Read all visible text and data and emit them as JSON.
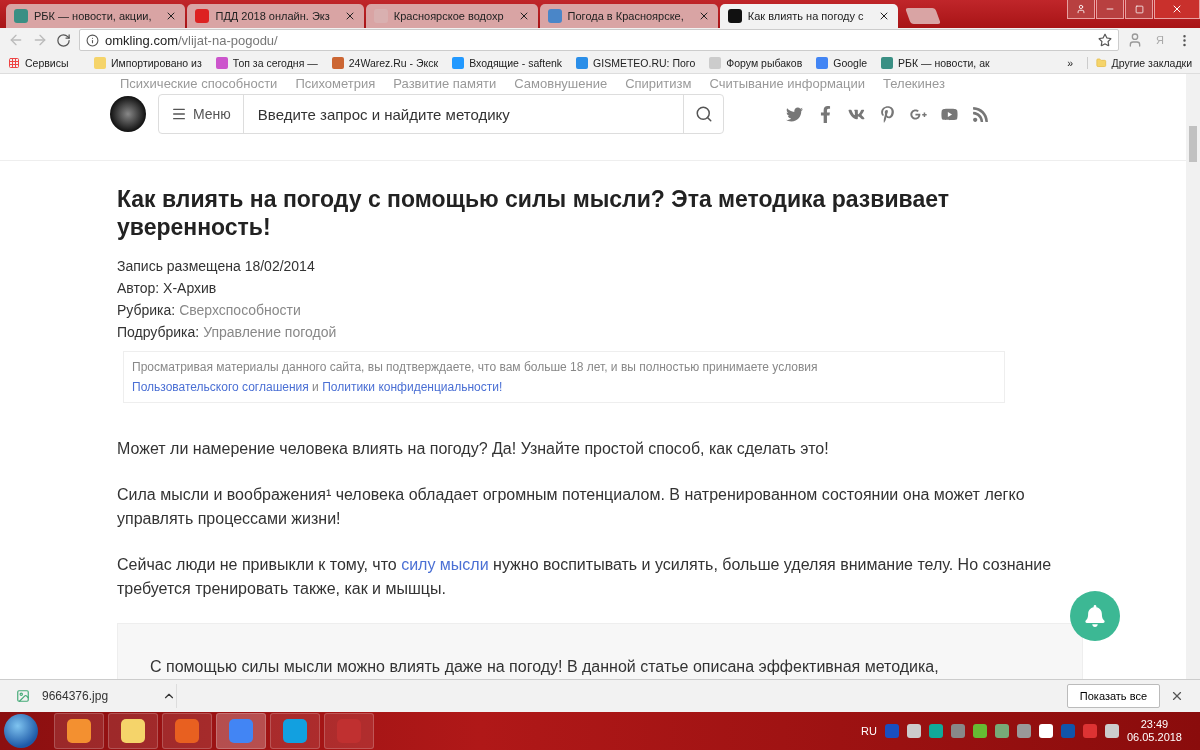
{
  "browser": {
    "tabs": [
      {
        "title": "РБК — новости, акции,",
        "selected": false
      },
      {
        "title": "ПДД 2018 онлайн. Экз",
        "selected": false
      },
      {
        "title": "Красноярское водохр",
        "selected": false
      },
      {
        "title": "Погода в Красноярске,",
        "selected": false
      },
      {
        "title": "Как влиять на погоду с",
        "selected": true
      }
    ],
    "address": {
      "host": "omkling.com",
      "path": "/vlijat-na-pogodu/"
    },
    "profile_letter": "Я",
    "bookmarks": [
      "Сервисы",
      "Импортировано из",
      "Топ за сегодня —",
      "24Warez.Ru - Экск",
      "Входящие - saftenk",
      "GISMETEO.RU: Пого",
      "Форум рыбаков",
      "Google",
      "РБК — новости, ак"
    ],
    "more": "»",
    "other_bookmarks": "Другие закладки"
  },
  "site": {
    "nav": [
      "Психические способности",
      "Психометрия",
      "Развитие памяти",
      "Самовнушение",
      "Спиритизм",
      "Считывание информации",
      "Телекинез"
    ],
    "menu_label": "Меню",
    "search_placeholder": "Введите запрос и найдите методику"
  },
  "article": {
    "title": "Как влиять на погоду с помощью силы мысли? Эта методика развивает уверенность!",
    "meta": [
      {
        "label": "Запись размещена 18/02/2014"
      },
      {
        "label": "Автор: X-Архив"
      },
      {
        "label": "Рубрика:",
        "value": "Сверхспособности"
      },
      {
        "label": "Подрубрика:",
        "value": "Управление погодой"
      }
    ],
    "notice": [
      {
        "text": "Просматривая материалы данного сайта, вы подтверждаете, что вам больше 18 лет, и вы полностью принимаете условия ",
        "link": false
      },
      {
        "text": "Пользовательского соглашения",
        "link": true
      },
      {
        "text": " и ",
        "link": false
      },
      {
        "text": "Политики конфиденциальности!",
        "link": true
      }
    ],
    "paragraphs": [
      [
        {
          "text": "Может ли намерение человека влиять на погоду? Да! Узнайте простой способ, как сделать это!",
          "link": false
        }
      ],
      [
        {
          "text": "Сила мысли и воображения¹ человека обладает огромным потенциалом. В натренированном состоянии она может легко управлять процессами жизни!",
          "link": false
        }
      ],
      [
        {
          "text": "Сейчас люди не привыкли к тому, что ",
          "link": false
        },
        {
          "text": "силу мысли",
          "link": true
        },
        {
          "text": " нужно воспитывать и усилять, больше уделяя внимание телу. Но сознание требуется тренировать также, как и мышцы.",
          "link": false
        }
      ]
    ],
    "quote": "С помощью силы мысли можно влиять даже на погоду! В данной статье описана эффективная методика,"
  },
  "downloads": {
    "file": "9664376.jpg",
    "show_all": "Показать все"
  },
  "taskbar": {
    "language": "RU",
    "time": "23:49",
    "date": "06.05.2018"
  }
}
